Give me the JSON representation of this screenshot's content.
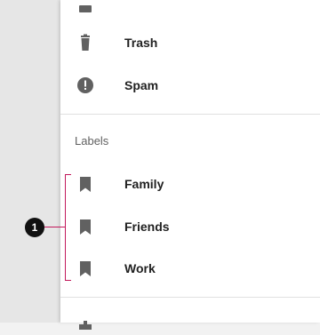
{
  "menu": {
    "items": [
      {
        "label": "Trash",
        "icon": "trash-icon"
      },
      {
        "label": "Spam",
        "icon": "spam-icon"
      }
    ]
  },
  "labels_section": {
    "header": "Labels",
    "items": [
      {
        "label": "Family",
        "icon": "label-icon"
      },
      {
        "label": "Friends",
        "icon": "label-icon"
      },
      {
        "label": "Work",
        "icon": "label-icon"
      }
    ]
  },
  "annotation": {
    "number": "1",
    "color": "#c2185b"
  },
  "colors": {
    "icon": "#616161",
    "text": "#212121",
    "divider": "#e0e0e0"
  }
}
